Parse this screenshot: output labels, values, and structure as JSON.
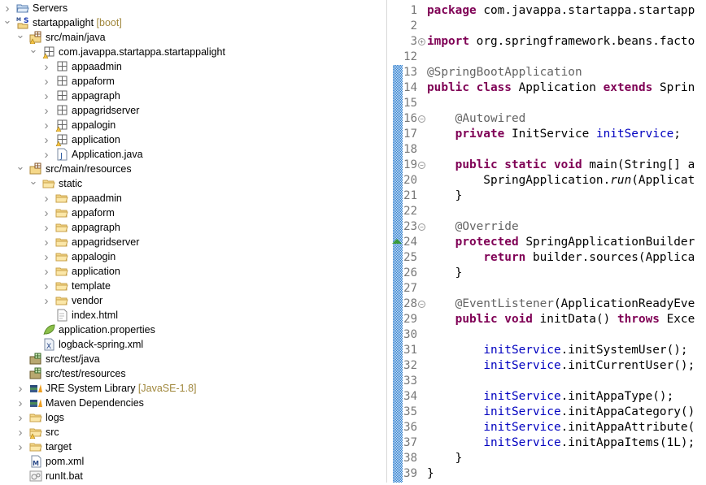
{
  "tree": [
    {
      "label": "Servers",
      "level": 0,
      "chev": "collapsed",
      "icon": "folder-open-blue"
    },
    {
      "label": "startappalight",
      "deco": "[boot]",
      "level": 0,
      "chev": "expanded",
      "icon": "maven-spring-project"
    },
    {
      "label": "src/main/java",
      "level": 1,
      "chev": "expanded",
      "icon": "source-folder",
      "warn": true
    },
    {
      "label": "com.javappa.startappa.startappalight",
      "level": 2,
      "chev": "expanded",
      "icon": "package",
      "warn": true
    },
    {
      "label": "appaadmin",
      "level": 3,
      "chev": "collapsed",
      "icon": "package"
    },
    {
      "label": "appaform",
      "level": 3,
      "chev": "collapsed",
      "icon": "package"
    },
    {
      "label": "appagraph",
      "level": 3,
      "chev": "collapsed",
      "icon": "package"
    },
    {
      "label": "appagridserver",
      "level": 3,
      "chev": "collapsed",
      "icon": "package"
    },
    {
      "label": "appalogin",
      "level": 3,
      "chev": "collapsed",
      "icon": "package",
      "warn": true
    },
    {
      "label": "application",
      "level": 3,
      "chev": "collapsed",
      "icon": "package",
      "warn": true
    },
    {
      "label": "Application.java",
      "level": 3,
      "chev": "collapsed",
      "icon": "java-file"
    },
    {
      "label": "src/main/resources",
      "level": 1,
      "chev": "expanded",
      "icon": "source-folder"
    },
    {
      "label": "static",
      "level": 2,
      "chev": "expanded",
      "icon": "folder"
    },
    {
      "label": "appaadmin",
      "level": 3,
      "chev": "collapsed",
      "icon": "folder"
    },
    {
      "label": "appaform",
      "level": 3,
      "chev": "collapsed",
      "icon": "folder"
    },
    {
      "label": "appagraph",
      "level": 3,
      "chev": "collapsed",
      "icon": "folder"
    },
    {
      "label": "appagridserver",
      "level": 3,
      "chev": "collapsed",
      "icon": "folder"
    },
    {
      "label": "appalogin",
      "level": 3,
      "chev": "collapsed",
      "icon": "folder"
    },
    {
      "label": "application",
      "level": 3,
      "chev": "collapsed",
      "icon": "folder"
    },
    {
      "label": "template",
      "level": 3,
      "chev": "collapsed",
      "icon": "folder"
    },
    {
      "label": "vendor",
      "level": 3,
      "chev": "collapsed",
      "icon": "folder"
    },
    {
      "label": "index.html",
      "level": 3,
      "chev": "none",
      "icon": "html-file"
    },
    {
      "label": "application.properties",
      "level": 2,
      "chev": "none",
      "icon": "spring-leaf"
    },
    {
      "label": "logback-spring.xml",
      "level": 2,
      "chev": "none",
      "icon": "xml-file"
    },
    {
      "label": "src/test/java",
      "level": 1,
      "chev": "none",
      "icon": "source-folder-green"
    },
    {
      "label": "src/test/resources",
      "level": 1,
      "chev": "none",
      "icon": "source-folder-green"
    },
    {
      "label": "JRE System Library",
      "deco": "[JavaSE-1.8]",
      "level": 1,
      "chev": "collapsed",
      "icon": "library"
    },
    {
      "label": "Maven Dependencies",
      "level": 1,
      "chev": "collapsed",
      "icon": "library"
    },
    {
      "label": "logs",
      "level": 1,
      "chev": "collapsed",
      "icon": "folder"
    },
    {
      "label": "src",
      "level": 1,
      "chev": "collapsed",
      "icon": "folder",
      "warn": true
    },
    {
      "label": "target",
      "level": 1,
      "chev": "collapsed",
      "icon": "folder"
    },
    {
      "label": "pom.xml",
      "level": 1,
      "chev": "none",
      "icon": "maven-pom"
    },
    {
      "label": "runIt.bat",
      "level": 1,
      "chev": "none",
      "icon": "bat-file"
    }
  ],
  "editor": {
    "lines": [
      {
        "n": "1",
        "t": [
          [
            "kw",
            "package"
          ],
          [
            "",
            "com.javappa.startappa.startapp"
          ]
        ]
      },
      {
        "n": "2",
        "t": []
      },
      {
        "n": "3",
        "fold": "plus",
        "t": [
          [
            "kw",
            "import"
          ],
          [
            "",
            "org.springframework.beans.facto"
          ]
        ]
      },
      {
        "n": "12",
        "t": []
      },
      {
        "n": "13",
        "t": [
          [
            "ann",
            "@SpringBootApplication"
          ]
        ]
      },
      {
        "n": "14",
        "t": [
          [
            "kw",
            "public class"
          ],
          [
            "",
            "Application"
          ],
          [
            "kw",
            "extends"
          ],
          [
            "",
            "Sprin"
          ]
        ]
      },
      {
        "n": "15",
        "t": []
      },
      {
        "n": "16",
        "fold": "minus",
        "t": [
          [
            "",
            "    "
          ],
          [
            "ann",
            "@Autowired"
          ]
        ]
      },
      {
        "n": "17",
        "t": [
          [
            "",
            "    "
          ],
          [
            "kw",
            "private"
          ],
          [
            "",
            "InitService"
          ],
          [
            "fld",
            "initService"
          ],
          [
            "",
            ";"
          ]
        ]
      },
      {
        "n": "18",
        "t": []
      },
      {
        "n": "19",
        "fold": "minus",
        "t": [
          [
            "",
            "    "
          ],
          [
            "kw",
            "public static void"
          ],
          [
            "",
            "main(String[] a"
          ]
        ]
      },
      {
        "n": "20",
        "t": [
          [
            "",
            "        SpringApplication."
          ],
          [
            "it",
            "run"
          ],
          [
            "",
            "(Applicat"
          ]
        ]
      },
      {
        "n": "21",
        "t": [
          [
            "",
            "    }"
          ]
        ]
      },
      {
        "n": "22",
        "t": []
      },
      {
        "n": "23",
        "fold": "minus",
        "t": [
          [
            "",
            "    "
          ],
          [
            "ann",
            "@Override"
          ]
        ]
      },
      {
        "n": "24",
        "override": true,
        "t": [
          [
            "",
            "    "
          ],
          [
            "kw",
            "protected"
          ],
          [
            "",
            "SpringApplicationBuilder"
          ]
        ]
      },
      {
        "n": "25",
        "t": [
          [
            "",
            "        "
          ],
          [
            "kw",
            "return"
          ],
          [
            "",
            "builder.sources(Applica"
          ]
        ]
      },
      {
        "n": "26",
        "t": [
          [
            "",
            "    }"
          ]
        ]
      },
      {
        "n": "27",
        "t": []
      },
      {
        "n": "28",
        "fold": "minus",
        "t": [
          [
            "",
            "    "
          ],
          [
            "ann",
            "@EventListener"
          ],
          [
            "",
            "(ApplicationReadyEve"
          ]
        ]
      },
      {
        "n": "29",
        "t": [
          [
            "",
            "    "
          ],
          [
            "kw",
            "public void"
          ],
          [
            "",
            "initData()"
          ],
          [
            "kw",
            "throws"
          ],
          [
            "",
            "Exce"
          ]
        ]
      },
      {
        "n": "30",
        "t": []
      },
      {
        "n": "31",
        "t": [
          [
            "",
            "        "
          ],
          [
            "fld",
            "initService"
          ],
          [
            "",
            ".initSystemUser();"
          ]
        ]
      },
      {
        "n": "32",
        "t": [
          [
            "",
            "        "
          ],
          [
            "fld",
            "initService"
          ],
          [
            "",
            ".initCurrentUser();"
          ]
        ]
      },
      {
        "n": "33",
        "t": []
      },
      {
        "n": "34",
        "t": [
          [
            "",
            "        "
          ],
          [
            "fld",
            "initService"
          ],
          [
            "",
            ".initAppaType();"
          ]
        ]
      },
      {
        "n": "35",
        "t": [
          [
            "",
            "        "
          ],
          [
            "fld",
            "initService"
          ],
          [
            "",
            ".initAppaCategory()"
          ]
        ]
      },
      {
        "n": "36",
        "t": [
          [
            "",
            "        "
          ],
          [
            "fld",
            "initService"
          ],
          [
            "",
            ".initAppaAttribute("
          ]
        ]
      },
      {
        "n": "37",
        "t": [
          [
            "",
            "        "
          ],
          [
            "fld",
            "initService"
          ],
          [
            "",
            ".initAppaItems(1L);"
          ]
        ]
      },
      {
        "n": "38",
        "t": [
          [
            "",
            "    }"
          ]
        ]
      },
      {
        "n": "39",
        "t": [
          [
            "",
            "}"
          ]
        ]
      }
    ],
    "colors": {
      "keyword": "#7f0055",
      "annotation": "#646464",
      "field": "#0000c0",
      "change_bar": "#2f7fcf"
    }
  }
}
